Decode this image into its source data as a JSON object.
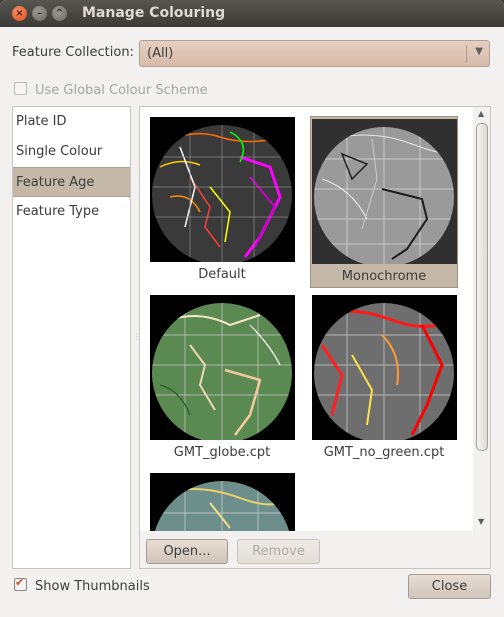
{
  "window": {
    "title": "Manage Colouring"
  },
  "feature_collection": {
    "label": "Feature Collection:",
    "value": "(All)"
  },
  "global_scheme": {
    "label": "Use Global Colour Scheme",
    "checked": false,
    "enabled": false
  },
  "categories": [
    {
      "label": "Plate ID",
      "selected": false
    },
    {
      "label": "Single Colour",
      "selected": false
    },
    {
      "label": "Feature Age",
      "selected": true
    },
    {
      "label": "Feature Type",
      "selected": false
    }
  ],
  "schemes": [
    {
      "name": "Default",
      "selected": false
    },
    {
      "name": "Monochrome",
      "selected": true
    },
    {
      "name": "GMT_globe.cpt",
      "selected": false
    },
    {
      "name": "GMT_no_green.cpt",
      "selected": false
    },
    {
      "name": "",
      "selected": false
    }
  ],
  "buttons": {
    "open": "Open...",
    "remove": "Remove",
    "close": "Close"
  },
  "show_thumbnails": {
    "label": "Show Thumbnails",
    "checked": true
  },
  "colors": {
    "selection": "#c4b9a8",
    "combo": "#d7bba9",
    "titlebar": "#3c3b37"
  }
}
